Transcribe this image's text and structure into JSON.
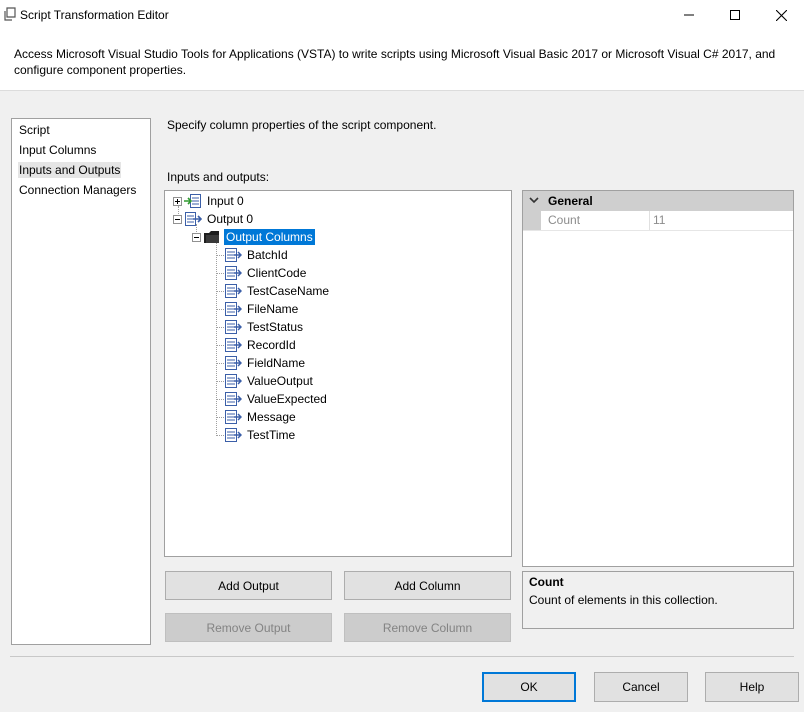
{
  "window": {
    "title": "Script Transformation Editor",
    "description": "Access Microsoft Visual Studio Tools for Applications (VSTA) to write scripts using Microsoft Visual Basic 2017 or Microsoft Visual C# 2017, and configure component properties."
  },
  "nav": {
    "items": [
      {
        "label": "Script"
      },
      {
        "label": "Input Columns"
      },
      {
        "label": "Inputs and Outputs",
        "selected": true
      },
      {
        "label": "Connection Managers"
      }
    ]
  },
  "main": {
    "heading": "Specify column properties of the script component.",
    "tree_label": "Inputs and outputs:",
    "tree": {
      "input": "Input 0",
      "output": "Output 0",
      "output_columns": "Output Columns",
      "columns": [
        "BatchId",
        "ClientCode",
        "TestCaseName",
        "FileName",
        "TestStatus",
        "RecordId",
        "FieldName",
        "ValueOutput",
        "ValueExpected",
        "Message",
        "TestTime"
      ]
    },
    "buttons": {
      "add_output": "Add Output",
      "add_column": "Add Column",
      "remove_output": "Remove Output",
      "remove_column": "Remove Column"
    }
  },
  "properties": {
    "category": "General",
    "rows": [
      {
        "name": "Count",
        "value": "11"
      }
    ],
    "description_title": "Count",
    "description_text": "Count of elements in this collection."
  },
  "footer": {
    "ok": "OK",
    "cancel": "Cancel",
    "help": "Help"
  },
  "colors": {
    "selection": "#0078d7",
    "default_button_border": "#0078d7",
    "category_header": "#cfcfcf"
  },
  "icons": [
    "script-app-icon",
    "minimize-icon",
    "maximize-icon",
    "close-icon",
    "input-icon",
    "output-icon",
    "folder-icon",
    "column-icon",
    "chevron-down-icon"
  ]
}
